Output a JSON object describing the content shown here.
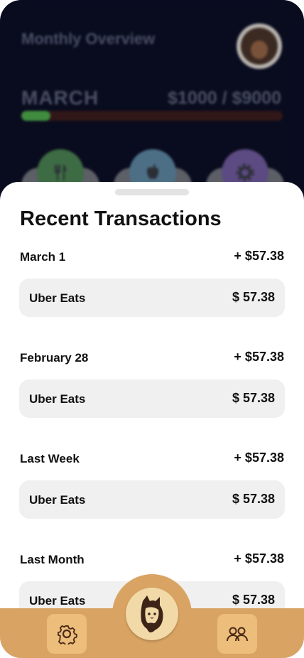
{
  "overview": {
    "title": "Monthly Overview",
    "month": "MARCH",
    "budget": "$1000 / $9000",
    "progress_fraction": 0.111
  },
  "categories": [
    {
      "icon": "fork-knife-icon"
    },
    {
      "icon": "apple-icon"
    },
    {
      "icon": "gear-icon"
    }
  ],
  "recent": {
    "title": "Recent Transactions",
    "groups": [
      {
        "date": "March 1",
        "total": "+ $57.38",
        "tx": {
          "name": "Uber Eats",
          "amount": "$ 57.38"
        }
      },
      {
        "date": "February 28",
        "total": "+ $57.38",
        "tx": {
          "name": "Uber Eats",
          "amount": "$ 57.38"
        }
      },
      {
        "date": "Last Week",
        "total": "+ $57.38",
        "tx": {
          "name": "Uber Eats",
          "amount": "$ 57.38"
        }
      },
      {
        "date": "Last Month",
        "total": "+ $57.38",
        "tx": {
          "name": "Uber Eats",
          "amount": "$ 57.38"
        }
      }
    ]
  },
  "nav": {
    "settings_icon": "gear-icon",
    "home_icon": "mascot-icon",
    "friends_icon": "users-icon"
  },
  "colors": {
    "background_dark": "#090c1e",
    "progress_fill": "#3f8c3f",
    "progress_track": "#311718",
    "nav": "#d9a463",
    "nav_button": "#ecbd7b",
    "transaction_card": "#f0f0f0"
  }
}
